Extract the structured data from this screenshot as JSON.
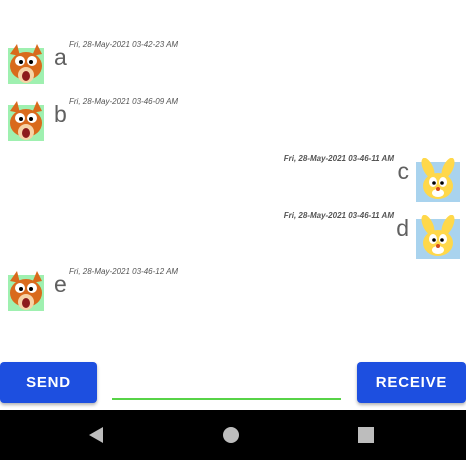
{
  "messages": [
    {
      "side": "left",
      "avatar": "squirrel-avatar",
      "timestamp": "Fri, 28-May-2021 03-42-23 AM",
      "text": "a"
    },
    {
      "side": "left",
      "avatar": "squirrel-avatar",
      "timestamp": "Fri, 28-May-2021 03-46-09 AM",
      "text": "b"
    },
    {
      "side": "right",
      "avatar": "rabbit-avatar",
      "timestamp": "Fri, 28-May-2021 03-46-11 AM",
      "text": "c"
    },
    {
      "side": "right",
      "avatar": "rabbit-avatar",
      "timestamp": "Fri, 28-May-2021 03-46-11 AM",
      "text": "d"
    },
    {
      "side": "left",
      "avatar": "squirrel-avatar",
      "timestamp": "Fri, 28-May-2021 03-46-12 AM",
      "text": "e"
    }
  ],
  "composer": {
    "send_label": "SEND",
    "receive_label": "RECEIVE",
    "input_value": "",
    "accent_color": "#1d4fe0",
    "input_underline_color": "#57d347"
  },
  "navbar": {
    "back": "back-triangle-icon",
    "home": "home-circle-icon",
    "recent": "recent-apps-square-icon"
  }
}
